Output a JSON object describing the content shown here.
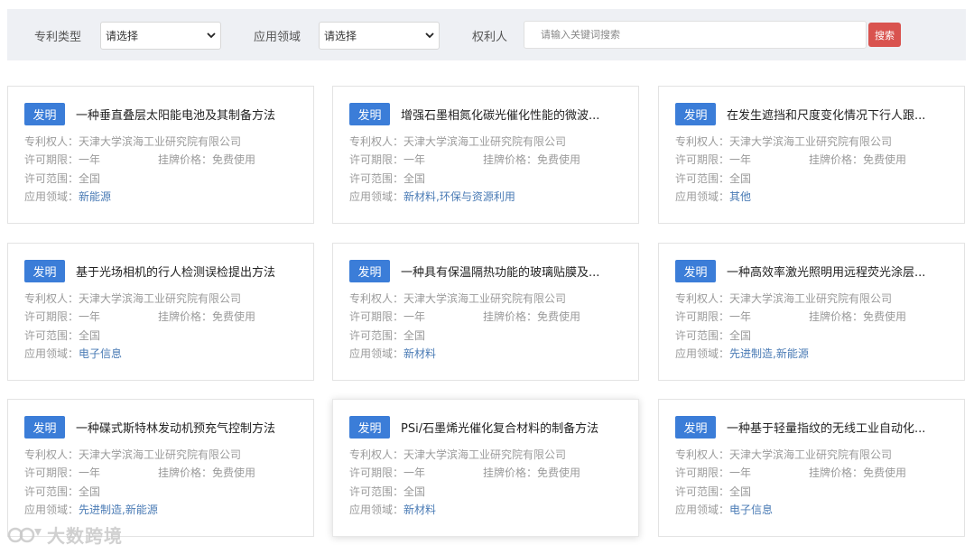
{
  "filters": {
    "type_label": "专利类型",
    "type_value": "请选择",
    "field_label": "应用领域",
    "field_value": "请选择",
    "owner_label": "权利人",
    "search_placeholder": "请输入关键词搜索",
    "search_button": "搜索"
  },
  "labels": {
    "owner": "专利权人：",
    "term": "许可期限：",
    "price": "挂牌价格：",
    "scope": "许可范围：",
    "field": "应用领域："
  },
  "cards": [
    {
      "badge": "发明",
      "title": "一种垂直叠层太阳能电池及其制备方法",
      "owner": "天津大学滨海工业研究院有限公司",
      "term": "一年",
      "price": "免费使用",
      "scope": "全国",
      "field": "新能源"
    },
    {
      "badge": "发明",
      "title": "增强石墨相氮化碳光催化性能的微波...",
      "owner": "天津大学滨海工业研究院有限公司",
      "term": "一年",
      "price": "免费使用",
      "scope": "全国",
      "field": "新材料,环保与资源利用"
    },
    {
      "badge": "发明",
      "title": "在发生遮挡和尺度变化情况下行人跟...",
      "owner": "天津大学滨海工业研究院有限公司",
      "term": "一年",
      "price": "免费使用",
      "scope": "全国",
      "field": "其他"
    },
    {
      "badge": "发明",
      "title": "基于光场相机的行人检测误检提出方法",
      "owner": "天津大学滨海工业研究院有限公司",
      "term": "一年",
      "price": "免费使用",
      "scope": "全国",
      "field": "电子信息"
    },
    {
      "badge": "发明",
      "title": "一种具有保温隔热功能的玻璃贴膜及...",
      "owner": "天津大学滨海工业研究院有限公司",
      "term": "一年",
      "price": "免费使用",
      "scope": "全国",
      "field": "新材料"
    },
    {
      "badge": "发明",
      "title": "一种高效率激光照明用远程荧光涂层...",
      "owner": "天津大学滨海工业研究院有限公司",
      "term": "一年",
      "price": "免费使用",
      "scope": "全国",
      "field": "先进制造,新能源"
    },
    {
      "badge": "发明",
      "title": "一种碟式斯特林发动机预充气控制方法",
      "owner": "天津大学滨海工业研究院有限公司",
      "term": "一年",
      "price": "免费使用",
      "scope": "全国",
      "field": "先进制造,新能源"
    },
    {
      "badge": "发明",
      "title": "PSi/石墨烯光催化复合材料的制备方法",
      "owner": "天津大学滨海工业研究院有限公司",
      "term": "一年",
      "price": "免费使用",
      "scope": "全国",
      "field": "新材料"
    },
    {
      "badge": "发明",
      "title": "一种基于轻量指纹的无线工业自动化...",
      "owner": "天津大学滨海工业研究院有限公司",
      "term": "一年",
      "price": "免费使用",
      "scope": "全国",
      "field": "电子信息"
    }
  ],
  "watermark": "大数跨境",
  "colors": {
    "badge": "#3b7dd8",
    "search_button": "#d9534f",
    "link": "#4a7bb5",
    "filter_bg": "#eef0f4"
  }
}
